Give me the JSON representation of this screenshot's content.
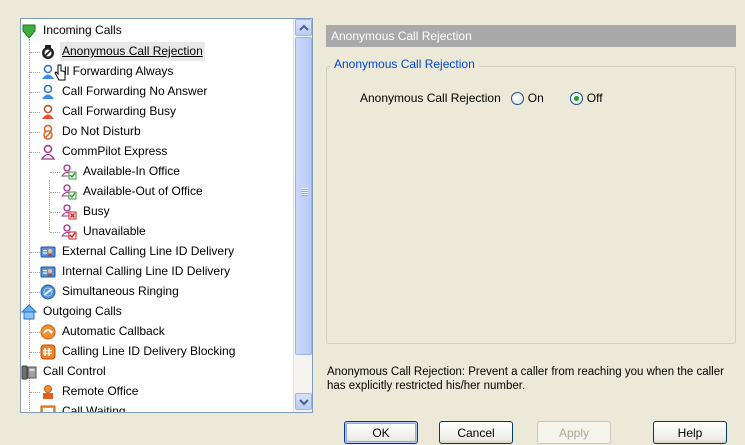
{
  "tree": {
    "items": [
      {
        "label": "Incoming Calls",
        "icon": "green-down-arrow-icon"
      },
      {
        "label": "Anonymous Call Rejection",
        "icon": "anonymous-rejection-icon"
      },
      {
        "label": "ll Forwarding Always",
        "icon": "call-forward-icon"
      },
      {
        "label": "Call Forwarding No Answer",
        "icon": "call-forward-icon"
      },
      {
        "label": "Call Forwarding Busy",
        "icon": "call-forward-busy-icon"
      },
      {
        "label": "Do Not Disturb",
        "icon": "do-not-disturb-icon"
      },
      {
        "label": "CommPilot Express",
        "icon": "person-icon"
      },
      {
        "label": "Available-In Office",
        "icon": "person-check-icon"
      },
      {
        "label": "Available-Out of Office",
        "icon": "person-check-icon"
      },
      {
        "label": "Busy",
        "icon": "person-busy-icon"
      },
      {
        "label": "Unavailable",
        "icon": "person-unavailable-icon"
      },
      {
        "label": "External Calling Line ID Delivery",
        "icon": "id-card-icon"
      },
      {
        "label": "Internal Calling Line ID Delivery",
        "icon": "id-card-icon"
      },
      {
        "label": "Simultaneous Ringing",
        "icon": "ringing-icon"
      },
      {
        "label": "Outgoing Calls",
        "icon": "house-icon"
      },
      {
        "label": "Automatic Callback",
        "icon": "callback-icon"
      },
      {
        "label": "Calling Line ID Delivery Blocking",
        "icon": "blocking-icon"
      },
      {
        "label": "Call Control",
        "icon": "phone-icon"
      },
      {
        "label": "Remote Office",
        "icon": "remote-office-icon"
      },
      {
        "label": "Call Waiting",
        "icon": "call-waiting-icon"
      }
    ]
  },
  "panel": {
    "header": "Anonymous Call Rejection",
    "group_legend": "Anonymous Call Rejection",
    "setting_label": "Anonymous Call Rejection",
    "option_on": "On",
    "option_off": "Off",
    "selected": "Off",
    "description": "Anonymous Call Rejection: Prevent a caller from reaching you when the caller has explicitly restricted his/her number."
  },
  "buttons": {
    "ok": "OK",
    "cancel": "Cancel",
    "apply": "Apply",
    "help": "Help"
  }
}
